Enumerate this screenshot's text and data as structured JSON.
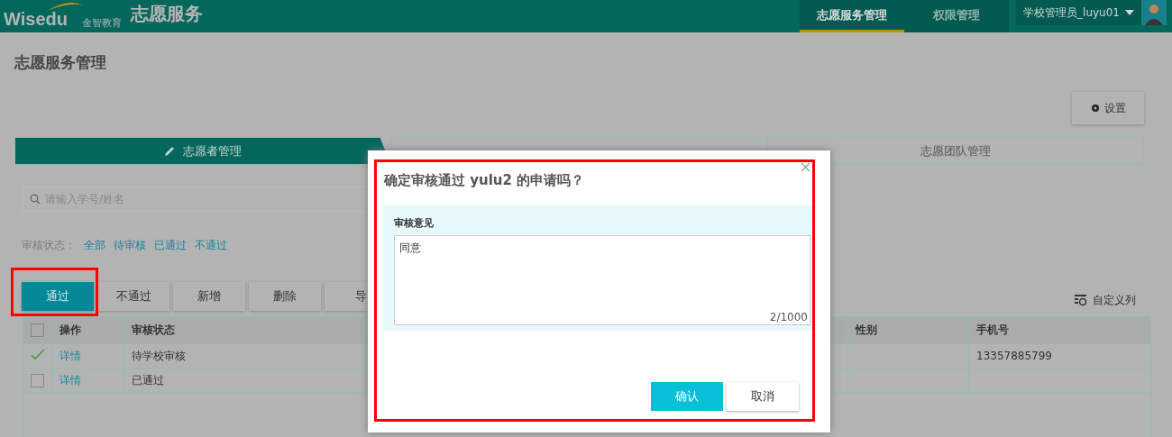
{
  "header": {
    "logo": "Wisedu",
    "logo_subtitle": "金智教育",
    "app_title": "志愿服务",
    "nav": [
      {
        "label": "志愿服务管理",
        "selected": true
      },
      {
        "label": "权限管理",
        "selected": false
      }
    ],
    "user": "学校管理员_luyu01"
  },
  "page_title": "志愿服务管理",
  "settings_button": "设置",
  "steps": [
    {
      "label": "志愿者管理",
      "selected": true
    },
    {
      "selected": false
    },
    {
      "label": "志愿团队管理",
      "selected": false
    }
  ],
  "search": {
    "placeholder": "请输入学号/姓名"
  },
  "filter": {
    "label": "审核状态：",
    "options": [
      "全部",
      "待审核",
      "已通过",
      "不通过"
    ]
  },
  "toolbar": [
    {
      "label": "通过",
      "selected": true
    },
    {
      "label": "不通过",
      "selected": false
    },
    {
      "label": "新增",
      "selected": false
    },
    {
      "label": "删除",
      "selected": false
    },
    {
      "label": "导",
      "selected": false
    }
  ],
  "custom_columns": "自定义列",
  "table": {
    "all_checked": false,
    "columns": [
      "操作",
      "审核状态",
      "性别",
      "手机号"
    ],
    "rows": [
      {
        "checked": true,
        "action": "详情",
        "status": "待学校审核",
        "phone": "13357885799"
      },
      {
        "checked": false,
        "action": "详情",
        "status": "已通过"
      }
    ]
  },
  "dialog": {
    "title": "确定审核通过 yulu2 的申请吗？",
    "field_label": "审核意见",
    "value": "同意",
    "counter": "2/1000",
    "buttons": [
      {
        "label": "确认",
        "kind": "primary"
      },
      {
        "label": "取消",
        "kind": "secondary"
      }
    ]
  },
  "annotations": [
    {
      "kind": "frame"
    },
    {
      "kind": "frame"
    }
  ]
}
